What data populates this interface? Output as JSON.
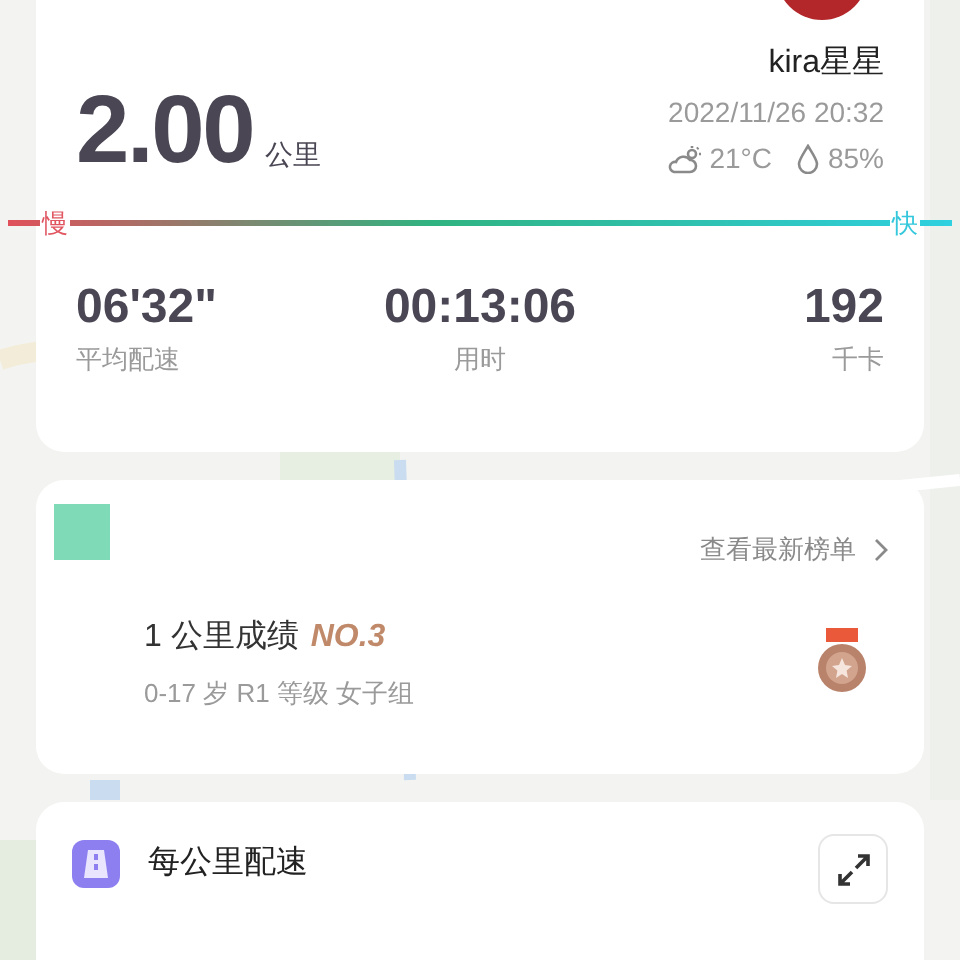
{
  "summary": {
    "distance": "2.00",
    "distance_unit": "公里",
    "user_name": "kira星星",
    "datetime": "2022/11/26 20:32",
    "temperature": "21°C",
    "humidity": "85%",
    "speed_scale": {
      "slow": "慢",
      "fast": "快"
    },
    "stats": [
      {
        "value": "06'32\"",
        "label": "平均配速"
      },
      {
        "value": "00:13:06",
        "label": "用时"
      },
      {
        "value": "192",
        "label": "千卡"
      }
    ]
  },
  "ranking": {
    "link": "查看最新榜单",
    "title": "1 公里成绩",
    "rank": "NO.3",
    "detail": "0-17 岁 R1 等级 女子组"
  },
  "pace_section": {
    "title": "每公里配速"
  }
}
